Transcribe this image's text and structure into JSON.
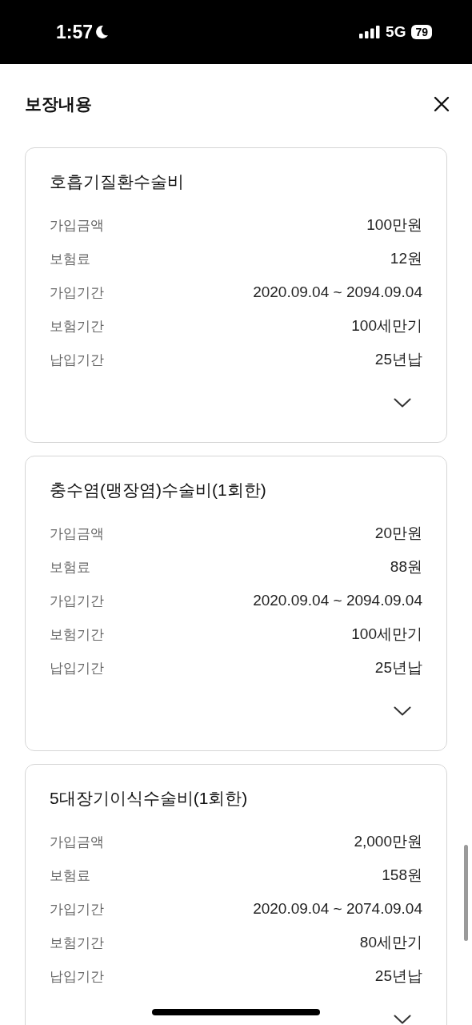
{
  "status_bar": {
    "time": "1:57",
    "network": "5G",
    "battery": "79"
  },
  "header": {
    "title": "보장내용"
  },
  "cards": [
    {
      "title": "호흡기질환수술비",
      "rows": [
        {
          "label": "가입금액",
          "value": "100만원"
        },
        {
          "label": "보험료",
          "value": "12원"
        },
        {
          "label": "가입기간",
          "value": "2020.09.04 ~ 2094.09.04"
        },
        {
          "label": "보험기간",
          "value": "100세만기"
        },
        {
          "label": "납입기간",
          "value": "25년납"
        }
      ]
    },
    {
      "title": "충수염(맹장염)수술비(1회한)",
      "rows": [
        {
          "label": "가입금액",
          "value": "20만원"
        },
        {
          "label": "보험료",
          "value": "88원"
        },
        {
          "label": "가입기간",
          "value": "2020.09.04 ~ 2094.09.04"
        },
        {
          "label": "보험기간",
          "value": "100세만기"
        },
        {
          "label": "납입기간",
          "value": "25년납"
        }
      ]
    },
    {
      "title": "5대장기이식수술비(1회한)",
      "rows": [
        {
          "label": "가입금액",
          "value": "2,000만원"
        },
        {
          "label": "보험료",
          "value": "158원"
        },
        {
          "label": "가입기간",
          "value": "2020.09.04 ~ 2074.09.04"
        },
        {
          "label": "보험기간",
          "value": "80세만기"
        },
        {
          "label": "납입기간",
          "value": "25년납"
        }
      ]
    }
  ]
}
